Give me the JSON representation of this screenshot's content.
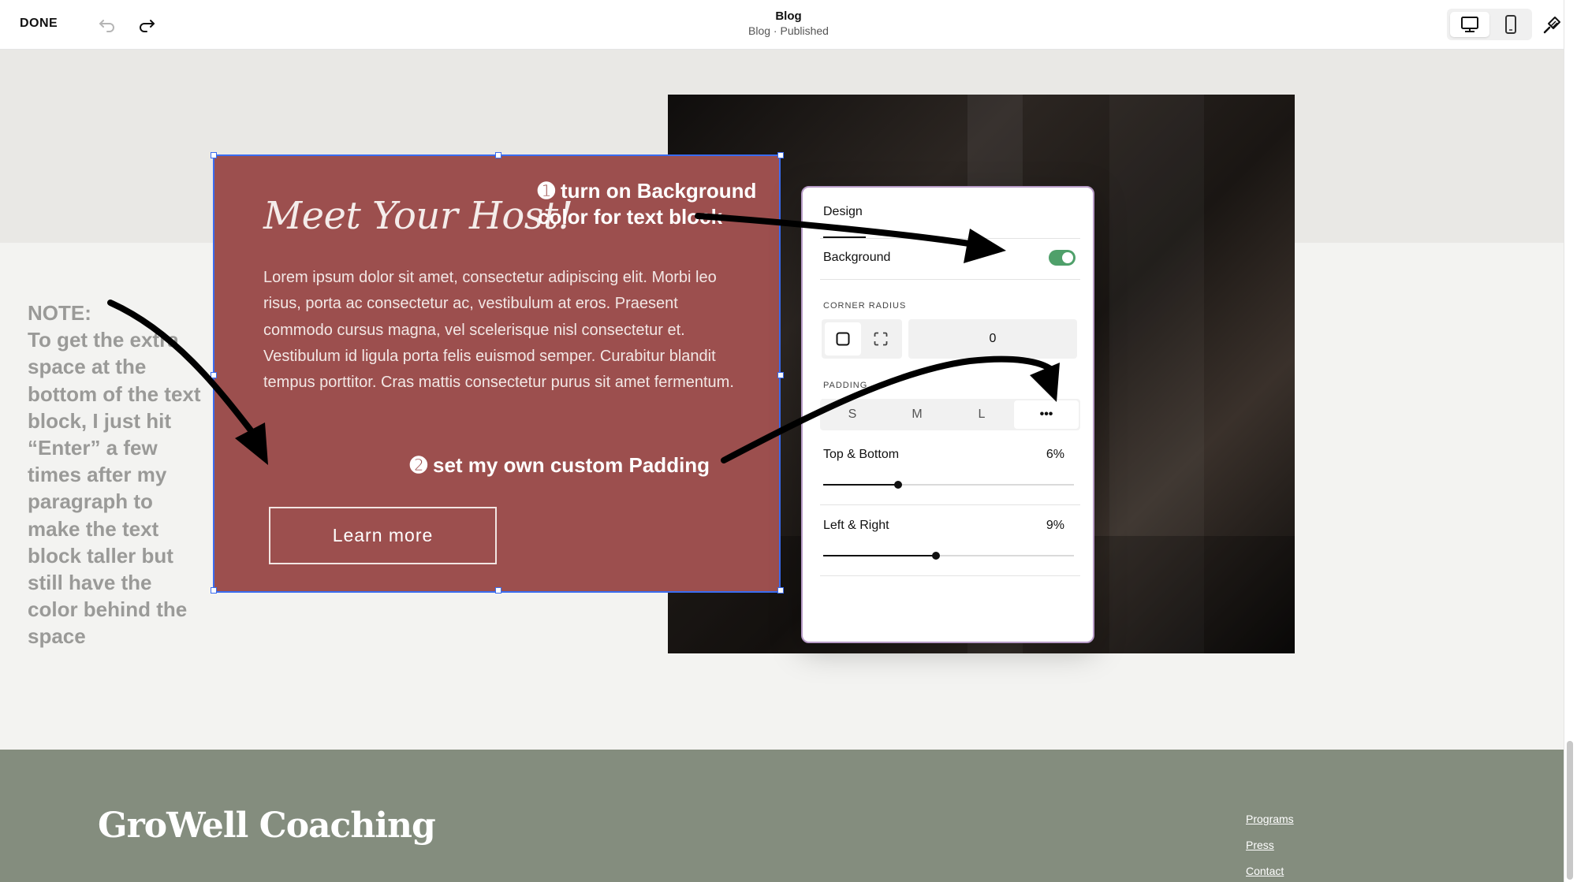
{
  "topbar": {
    "done_label": "DONE",
    "page_title": "Blog",
    "page_subtitle": "Blog · Published"
  },
  "text_block": {
    "heading": "Meet Your Host!",
    "paragraph": "Lorem ipsum dolor sit amet, consectetur adipiscing elit. Morbi leo risus, porta ac consectetur ac, vestibulum at eros. Praesent commodo cursus magna, vel scelerisque nisl consectetur et. Vestibulum id ligula porta felis euismod semper. Curabitur blandit tempus porttitor. Cras mattis consectetur purus sit amet fermentum.",
    "button_label": "Learn more",
    "background_color": "#9c4f4e"
  },
  "annotations": {
    "step1_line1": "➊ turn on Background",
    "step1_line2": "color for text block",
    "step2": "➋ set my own custom Padding",
    "note_title": "NOTE:",
    "note_body": "To get the extra space at the bottom of the text block, I just hit “Enter” a few times after my paragraph to make the text block taller but still have the color behind the space"
  },
  "design_panel": {
    "title": "Design",
    "background_label": "Background",
    "background_on": true,
    "corner_radius_label": "CORNER RADIUS",
    "corner_radius_value": "0",
    "padding_label": "PADDING",
    "padding_options": [
      "S",
      "M",
      "L",
      "•••"
    ],
    "padding_selected": "•••",
    "top_bottom": {
      "label": "Top & Bottom",
      "value": "6%",
      "level": 0.3
    },
    "left_right": {
      "label": "Left & Right",
      "value": "9%",
      "level": 0.45
    },
    "toggle_color": "#4fa06a"
  },
  "footer": {
    "logo": "GroWell Coaching",
    "links": [
      "Programs",
      "Press",
      "Contact"
    ],
    "background_color": "#848d7e"
  }
}
